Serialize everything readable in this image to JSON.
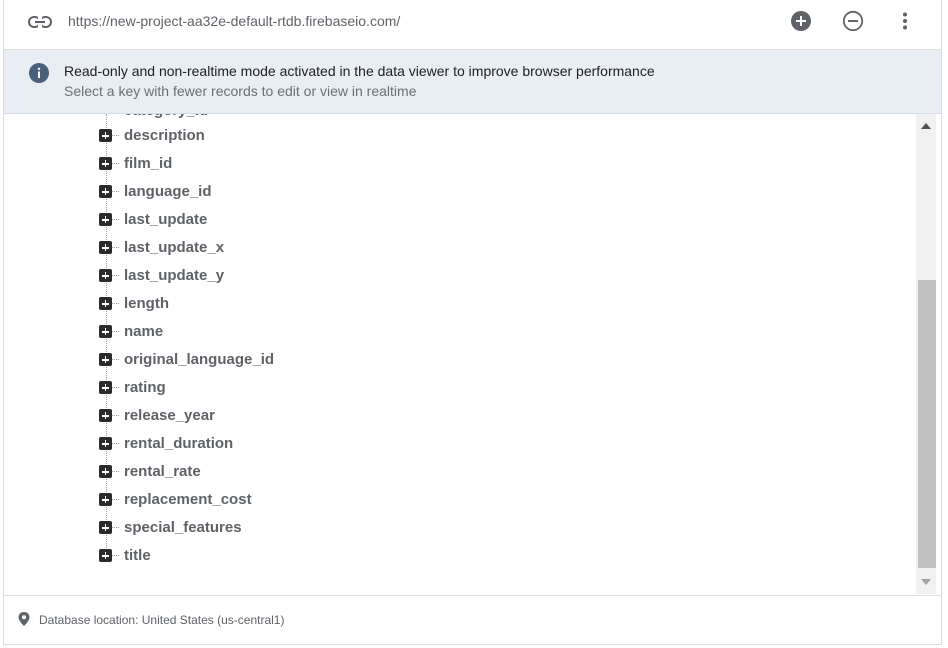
{
  "urlbar": {
    "url": "https://new-project-aa32e-default-rtdb.firebaseio.com/",
    "icons": {
      "link": "link-icon",
      "add": "add-circle-icon",
      "remove": "remove-circle-icon",
      "more": "more-vert-icon"
    }
  },
  "banner": {
    "icon": "info-icon",
    "title": "Read-only and non-realtime mode activated in the data viewer to improve browser performance",
    "subtitle": "Select a key with fewer records to edit or view in realtime"
  },
  "tree": {
    "partial_key": "category_id",
    "items": [
      {
        "label": "description"
      },
      {
        "label": "film_id"
      },
      {
        "label": "language_id"
      },
      {
        "label": "last_update"
      },
      {
        "label": "last_update_x"
      },
      {
        "label": "last_update_y"
      },
      {
        "label": "length"
      },
      {
        "label": "name"
      },
      {
        "label": "original_language_id"
      },
      {
        "label": "rating"
      },
      {
        "label": "release_year"
      },
      {
        "label": "rental_duration"
      },
      {
        "label": "rental_rate"
      },
      {
        "label": "replacement_cost"
      },
      {
        "label": "special_features"
      },
      {
        "label": "title"
      }
    ]
  },
  "footer": {
    "icon": "location-pin-icon",
    "text": "Database location: United States (us-central1)"
  },
  "colors": {
    "banner_bg": "#e8eef4",
    "info_icon": "#4a5f7a",
    "expand_box": "#2b2b2b",
    "key_text": "#5f6368"
  }
}
